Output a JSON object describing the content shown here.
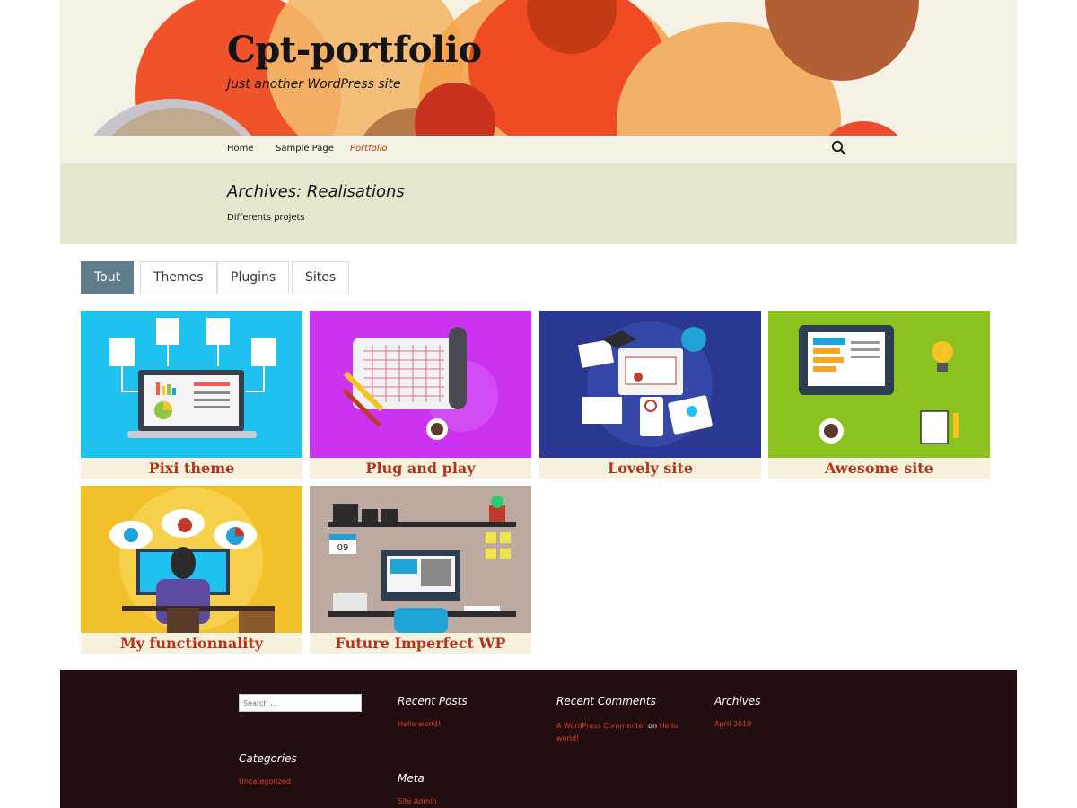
{
  "header": {
    "site_title": "Cpt-portfolio",
    "site_description": "Just another WordPress site"
  },
  "nav": {
    "items": [
      {
        "label": "Home",
        "active": false
      },
      {
        "label": "Sample Page",
        "active": false
      },
      {
        "label": "Portfolio",
        "active": true
      }
    ],
    "search_icon": "search-icon"
  },
  "archive": {
    "title": "Archives: Realisations",
    "description": "Differents projets"
  },
  "filters": [
    {
      "label": "Tout",
      "active": true
    },
    {
      "label": "Themes",
      "active": false
    },
    {
      "label": "Plugins",
      "active": false
    },
    {
      "label": "Sites",
      "active": false
    }
  ],
  "portfolio": [
    {
      "title": "Pixi theme",
      "bg": "#1fc2ee"
    },
    {
      "title": "Plug and play",
      "bg": "#cc33f0"
    },
    {
      "title": "Lovely site",
      "bg": "#2a3891"
    },
    {
      "title": "Awesome site",
      "bg": "#8cc21f"
    },
    {
      "title": "My functionnality",
      "bg": "#f2c02a"
    },
    {
      "title": "Future Imperfect WP",
      "bg": "#bcaaa0"
    }
  ],
  "illustration_text": {
    "calendar_day": "09"
  },
  "footer": {
    "search_placeholder": "Search …",
    "recent_posts": {
      "title": "Recent Posts",
      "items": [
        "Hello world!"
      ]
    },
    "recent_comments": {
      "title": "Recent Comments",
      "author": "A WordPress Commenter",
      "on": "on",
      "post": "Hello world!"
    },
    "archives": {
      "title": "Archives",
      "items": [
        "April 2019"
      ]
    },
    "categories": {
      "title": "Categories",
      "items": [
        "Uncategorized"
      ]
    },
    "meta": {
      "title": "Meta",
      "items": [
        "Site Admin"
      ]
    }
  },
  "colors": {
    "accent": "#bc360a",
    "footer_bg": "#220e10",
    "archive_bg": "#e8e5ce",
    "filter_active": "#607d8b"
  }
}
